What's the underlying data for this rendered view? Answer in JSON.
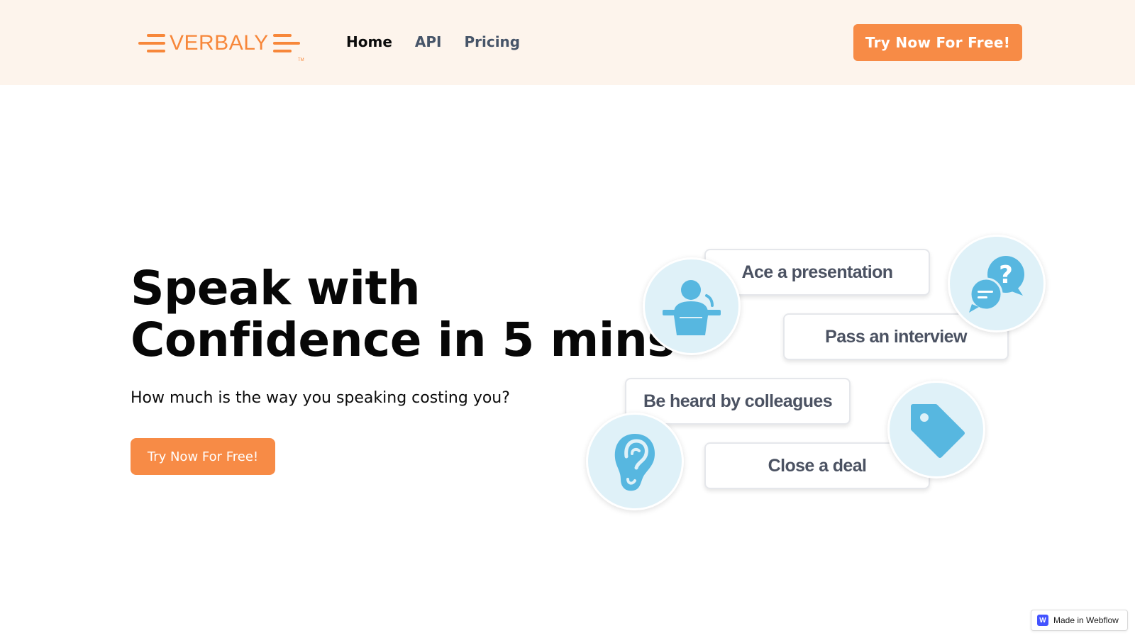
{
  "brand": {
    "name": "VERBALY",
    "trademark": "TM",
    "color": "#f7873a"
  },
  "nav": {
    "items": [
      {
        "label": "Home",
        "active": true
      },
      {
        "label": "API",
        "active": false
      },
      {
        "label": "Pricing",
        "active": false
      }
    ]
  },
  "header": {
    "cta_label": "Try Now For Free!"
  },
  "hero": {
    "title_line1": "Speak with",
    "title_line2": "Confidence in 5 mins",
    "subtitle": "How much is the way you speaking costing you?",
    "cta_label": "Try Now For Free!"
  },
  "illustration": {
    "goals": [
      {
        "label": "Ace a presentation",
        "icon": "presenter-icon"
      },
      {
        "label": "Pass an interview",
        "icon": "question-chat-icon"
      },
      {
        "label": "Be heard by colleagues",
        "icon": "ear-icon"
      },
      {
        "label": "Close a deal",
        "icon": "price-tag-icon"
      }
    ]
  },
  "badge": {
    "label": "Made in Webflow",
    "logo_letter": "W"
  },
  "colors": {
    "accent": "#f78b46",
    "header_bg": "#fdf4ec",
    "icon_blue": "#57b7e0",
    "icon_bg": "#dff1f8",
    "nav_inactive": "#475569"
  }
}
